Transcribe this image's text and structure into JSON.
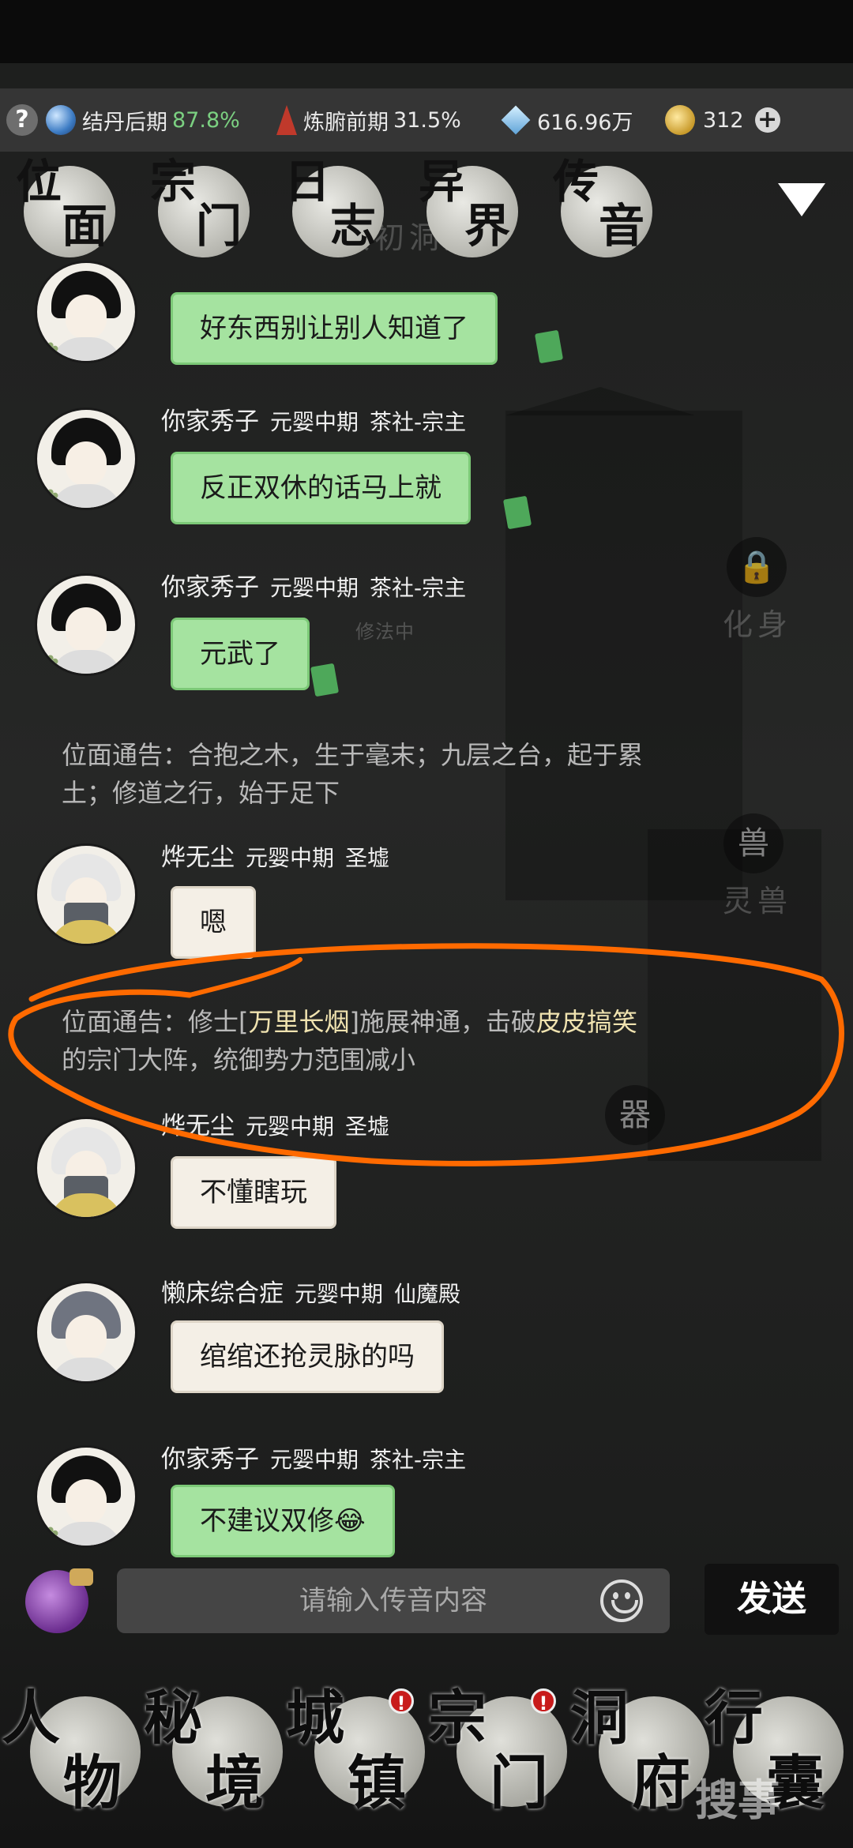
{
  "status": {
    "help_icon": "?",
    "cultivation_label": "结丹后期",
    "cultivation_pct": "87.8%",
    "body_label": "炼腑前期",
    "body_pct": "31.5%",
    "spirit_stones": "616.96万",
    "gold": "312",
    "plus_icon": "+"
  },
  "top_nav": [
    {
      "c1": "位",
      "c2": "面"
    },
    {
      "c1": "宗",
      "c2": "门"
    },
    {
      "c1": "日",
      "c2": "志"
    },
    {
      "c1": "异",
      "c2": "界"
    },
    {
      "c1": "传",
      "c2": "音"
    }
  ],
  "messages": [
    {
      "type": "chat",
      "name": "",
      "rank": "",
      "sect": "",
      "text": "好东西别让别人知道了",
      "style": "green"
    },
    {
      "type": "chat",
      "name": "你家秀子",
      "rank": "元婴中期",
      "sect": "茶社-宗主",
      "text": "反正双休的话马上就",
      "style": "green"
    },
    {
      "type": "chat",
      "name": "你家秀子",
      "rank": "元婴中期",
      "sect": "茶社-宗主",
      "text": "元武了",
      "style": "green"
    },
    {
      "type": "notice",
      "line1": "位面通告：合抱之木，生于毫末；九层之台，起于累",
      "line2": "土；修道之行，始于足下"
    },
    {
      "type": "chat",
      "name": "烨无尘",
      "rank": "元婴中期",
      "sect": "圣墟",
      "text": "嗯",
      "style": "white"
    },
    {
      "type": "notice2",
      "prefix": "位面通告：修士[",
      "name1": "万里长烟",
      "mid": "]施展神通，击破",
      "name2": "皮皮搞笑",
      "line2": "的宗门大阵，统御势力范围减小"
    },
    {
      "type": "chat",
      "name": "烨无尘",
      "rank": "元婴中期",
      "sect": "圣墟",
      "text": "不懂瞎玩",
      "style": "white"
    },
    {
      "type": "chat",
      "name": "懒床综合症",
      "rank": "元婴中期",
      "sect": "仙魔殿",
      "text": "绾绾还抢灵脉的吗",
      "style": "white"
    },
    {
      "type": "chat",
      "name": "你家秀子",
      "rank": "元婴中期",
      "sect": "茶社-宗主",
      "text": "不建议双修😂",
      "style": "green"
    }
  ],
  "background_labels": {
    "mansion": "太初洞府",
    "practicing": "修法中",
    "avatar_lock": "化身",
    "spirit_beast": "灵兽",
    "beast_char": "兽",
    "artifact_char": "器"
  },
  "input": {
    "placeholder": "请输入传音内容",
    "send_label": "发送"
  },
  "bottom_nav": [
    {
      "c1": "人",
      "c2": "物",
      "badge": ""
    },
    {
      "c1": "秘",
      "c2": "境",
      "badge": ""
    },
    {
      "c1": "城",
      "c2": "镇",
      "badge": "!"
    },
    {
      "c1": "宗",
      "c2": "门",
      "badge": "!"
    },
    {
      "c1": "洞",
      "c2": "府",
      "badge": ""
    },
    {
      "c1": "行",
      "c2": "囊",
      "badge": ""
    }
  ],
  "watermark": "搜事"
}
